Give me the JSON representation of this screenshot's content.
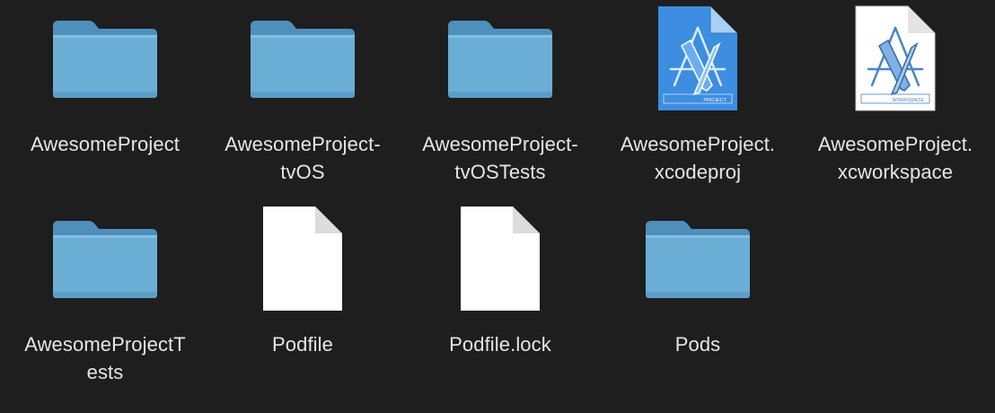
{
  "files": [
    {
      "id": "awesomeproject",
      "kind": "folder",
      "label": "AwesomeProject"
    },
    {
      "id": "awesomeproject-tvos",
      "kind": "folder",
      "label": "AwesomeProject-\ntvOS"
    },
    {
      "id": "awesomeproject-tvostests",
      "kind": "folder",
      "label": "AwesomeProject-\ntvOSTests"
    },
    {
      "id": "awesomeproject-xcodeproj",
      "kind": "xcodeproj",
      "label": "AwesomeProject.\nxcodeproj",
      "badge": "PROJECT"
    },
    {
      "id": "awesomeproject-xcworkspace",
      "kind": "xcworkspace",
      "label": "AwesomeProject.\nxcworkspace",
      "badge": "WORKSPACE"
    },
    {
      "id": "awesomeprojecttests",
      "kind": "folder",
      "label": "AwesomeProjectT\nests"
    },
    {
      "id": "podfile",
      "kind": "document",
      "label": "Podfile"
    },
    {
      "id": "podfile-lock",
      "kind": "document",
      "label": "Podfile.lock"
    },
    {
      "id": "pods",
      "kind": "folder",
      "label": "Pods"
    }
  ],
  "icons": {
    "folder": "folder-icon",
    "document": "document-icon",
    "xcodeproj": "xcode-project-icon",
    "xcworkspace": "xcode-workspace-icon"
  },
  "colors": {
    "background": "#1e1e1f",
    "label_text": "#e6e6e6",
    "folder_body": "#6aaed6",
    "folder_tab": "#4f8fbb",
    "project_blue": "#3d8de0",
    "document_white": "#ffffff"
  }
}
